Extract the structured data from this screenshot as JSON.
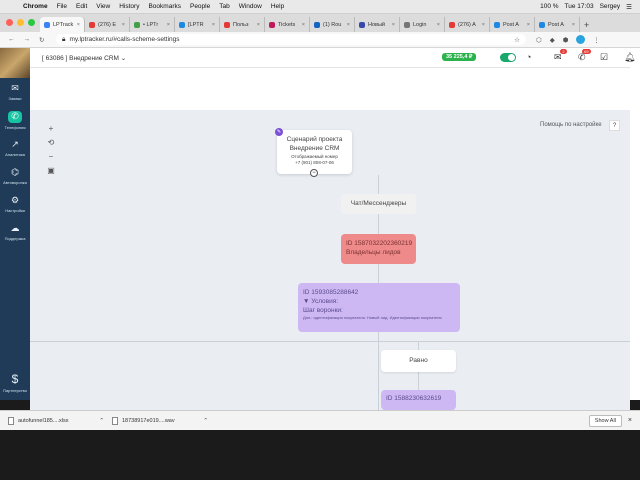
{
  "macos_menu": {
    "app": "Chrome",
    "items": [
      "File",
      "Edit",
      "View",
      "History",
      "Bookmarks",
      "People",
      "Tab",
      "Window",
      "Help"
    ],
    "battery": "100 %",
    "clock": "Tue 17:03",
    "user": "Sergey"
  },
  "tabs": [
    {
      "label": "LPTrack",
      "color": "#3b82f6",
      "active": true
    },
    {
      "label": "(276) E",
      "color": "#e53935"
    },
    {
      "label": "• LPTr",
      "color": "#43a047"
    },
    {
      "label": "[LPTR",
      "color": "#1e88e5"
    },
    {
      "label": "Польз",
      "color": "#e53935"
    },
    {
      "label": "Tickets",
      "color": "#c2185b"
    },
    {
      "label": "(1) Rou",
      "color": "#1565c0"
    },
    {
      "label": "Новый",
      "color": "#3949ab"
    },
    {
      "label": "Login",
      "color": "#757575"
    },
    {
      "label": "(276) A",
      "color": "#e53935"
    },
    {
      "label": "Post A",
      "color": "#1e88e5"
    },
    {
      "label": "Post A",
      "color": "#1e88e5"
    }
  ],
  "address": {
    "url": "my.lptracker.ru/#calls-scheme-settings"
  },
  "sidebar": {
    "items": [
      {
        "label": "Заявки",
        "icon": "mail-icon"
      },
      {
        "label": "Телефония",
        "icon": "phone-icon",
        "active": true
      },
      {
        "label": "Аналитика",
        "icon": "chart-icon"
      },
      {
        "label": "Автоворонка",
        "icon": "funnel-icon"
      },
      {
        "label": "Настройки",
        "icon": "gear-icon"
      },
      {
        "label": "Поддержка",
        "icon": "chat-icon"
      }
    ],
    "partner_label": "Партнерство"
  },
  "topbar": {
    "project": "[ 63086 ] Внедрение CRM",
    "balance": "35 225,4 ₽",
    "mail_badge": "2",
    "phone_badge": "69"
  },
  "help": {
    "label": "Помощь по настройке",
    "button": "?"
  },
  "zoom": {
    "plus": "+",
    "undo": "⟲",
    "minus": "−",
    "save": "▣"
  },
  "scheme": {
    "start": {
      "title": "Сценарий проекта",
      "subtitle": "Внедрение CRM",
      "phone_label": "Отображаемый номер",
      "phone": "+7 (901) 808-07-06"
    },
    "chat_node": "Чат/Мессенджеры",
    "owner_node": {
      "id": "ID 1587032202360219",
      "label": "Владельцы лидов"
    },
    "condition_node": {
      "id": "ID 1593085288642",
      "conditions_label": "Условия:",
      "funnel_label": "Шаг воронки:",
      "details": "Доп.: идентификация покупателя. Новый лид. Идентификация покупателя"
    },
    "equal_node": "Равно",
    "condition_node_2": {
      "id": "ID 1588230632619"
    }
  },
  "downloads": {
    "files": [
      "autofunnel185....xlsx",
      "18738917e019....wav"
    ],
    "show_all": "Show All"
  }
}
